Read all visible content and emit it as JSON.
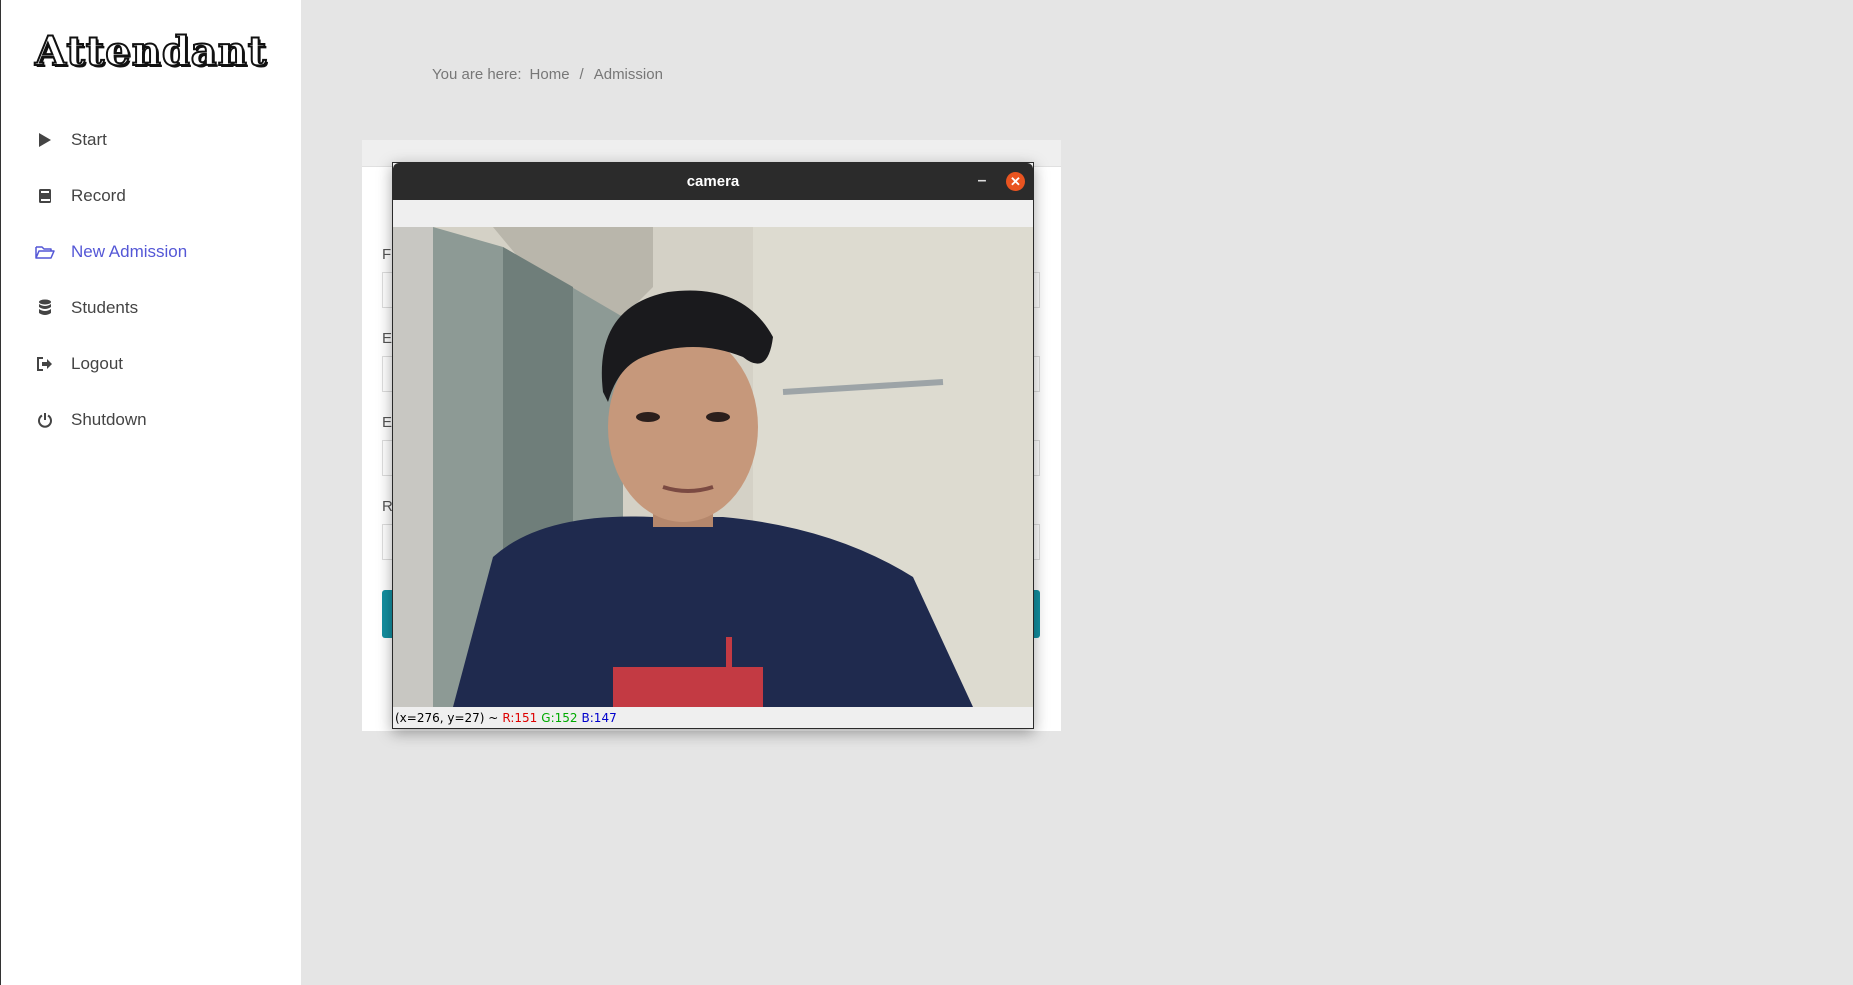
{
  "app": {
    "logo_text": "Attendant"
  },
  "sidebar": {
    "items": [
      {
        "label": "Start",
        "icon": "play-icon",
        "active": false
      },
      {
        "label": "Record",
        "icon": "book-icon",
        "active": false
      },
      {
        "label": "New Admission",
        "icon": "folder-open-icon",
        "active": true
      },
      {
        "label": "Students",
        "icon": "database-icon",
        "active": false
      },
      {
        "label": "Logout",
        "icon": "logout-icon",
        "active": false
      },
      {
        "label": "Shutdown",
        "icon": "power-icon",
        "active": false
      }
    ],
    "accent_color": "#5457d6"
  },
  "breadcrumb": {
    "prefix": "You are here:",
    "home": "Home",
    "separator": "/",
    "current": "Admission"
  },
  "form": {
    "labels": [
      "F",
      "E",
      "E",
      "R"
    ],
    "submit_color": "#138fa0"
  },
  "camera_window": {
    "title": "camera",
    "minimize_label": "–",
    "close_label": "✕",
    "status": {
      "coords": "(x=276, y=27) ~",
      "r": "R:151",
      "g": "G:152",
      "b": "B:147"
    }
  }
}
